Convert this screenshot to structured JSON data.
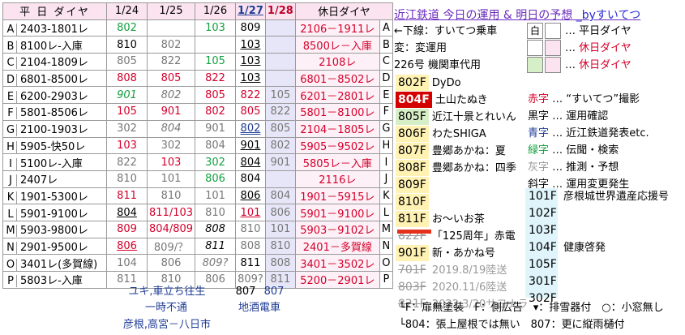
{
  "table": {
    "header": {
      "col_a": "平 日 ダイヤ",
      "dates": [
        "1/24",
        "1/25",
        "1/26",
        "1/27",
        "1/28"
      ],
      "holiday": "休日ダイヤ"
    },
    "rows": [
      {
        "letter": "A",
        "pair": "2403-1801レ",
        "d24": "802",
        "d25": "",
        "d26": "103",
        "d27": "809",
        "hol": "2106－1911レ",
        "letter2": "A"
      },
      {
        "letter": "B",
        "pair": "8100レ-入庫",
        "d24": "810",
        "d25": "802",
        "d26": "",
        "d27": "103",
        "hol": "8500レ－入庫",
        "letter2": "B"
      },
      {
        "letter": "C",
        "pair": "2104-1809レ",
        "d24": "805",
        "d25": "822",
        "d26": "105",
        "d27": "103",
        "hol": "2108レ",
        "letter2": "C"
      },
      {
        "letter": "D",
        "pair": "6801-8500レ",
        "d24": "808",
        "d25": "805",
        "d26": "822",
        "d27": "103",
        "hol": "6801－8502レ",
        "letter2": "D"
      },
      {
        "letter": "E",
        "pair": "6200-2903レ",
        "d24": "901",
        "d25": "802",
        "d26": "805",
        "d27": "822",
        "d28": "105",
        "hol": "6201－2801レ",
        "letter2": "E"
      },
      {
        "letter": "F",
        "pair": "5801-8506レ",
        "d24": "105",
        "d25": "901",
        "d26": "802",
        "d27": "805",
        "d28": "822",
        "hol": "5801－8100レ",
        "letter2": "F"
      },
      {
        "letter": "G",
        "pair": "2100-1903レ",
        "d24": "302",
        "d25": "804",
        "d26": "901",
        "d27": "802",
        "d28": "805",
        "hol": "2104－1805レ",
        "letter2": "G"
      },
      {
        "letter": "H",
        "pair": "5905-快50レ",
        "d24": "103",
        "d25": "302",
        "d26": "804",
        "d27": "901",
        "d28": "802",
        "hol": "5905－9502レ",
        "letter2": "H"
      },
      {
        "letter": "I",
        "pair": "5100レ-入庫",
        "d24": "822",
        "d25": "103",
        "d26": "302",
        "d27": "804",
        "d28": "901",
        "hol": "5805レ－入庫",
        "letter2": "I"
      },
      {
        "letter": "J",
        "pair": "2407レ",
        "d24": "810",
        "d25": "101",
        "d26": "806",
        "d27": "804",
        "d28": "",
        "hol": "2116レ",
        "letter2": "J"
      },
      {
        "letter": "K",
        "pair": "1901-5300レ",
        "d24": "811",
        "d25": "810",
        "d26": "101",
        "d27": "806",
        "d28": "804",
        "hol": "1901－5915レ",
        "letter2": "K"
      },
      {
        "letter": "L",
        "pair": "5901-9100レ",
        "d24": "804",
        "d25": "811/103",
        "d26": "810",
        "d27": "101",
        "d28": "806",
        "hol": "5901－9100レ",
        "letter2": "L"
      },
      {
        "letter": "M",
        "pair": "5903-9800レ",
        "d24": "809",
        "d25": "804/809",
        "d26": "808",
        "d27": "810",
        "d28": "101",
        "hol": "5903－9102レ",
        "letter2": "M"
      },
      {
        "letter": "N",
        "pair": "2901-9500レ",
        "d24": "806",
        "d25": "809/？",
        "d26": "811",
        "d27": "808",
        "d28": "810",
        "hol": "2401－多賀線",
        "letter2": "N"
      },
      {
        "letter": "O",
        "pair": "3401レ(多賀線)",
        "d24": "104",
        "d25": "806",
        "d26": "809?",
        "d27": "811",
        "d28": "808",
        "hol": "3401－3502レ",
        "letter2": "O"
      },
      {
        "letter": "P",
        "pair": "5803レ-入庫",
        "d24": "811",
        "d25": "810",
        "d26": "806",
        "d27": "809?",
        "d28": "811",
        "hol": "5200－2901レ",
        "letter2": "P"
      }
    ],
    "notes": [
      {
        "label": "ユキ,車立ち往生",
        "v27": "807",
        "v28": "807"
      },
      {
        "label": "一時不通",
        "v2": "地酒電車"
      },
      {
        "label": "彦根,高宮－八日市"
      }
    ]
  },
  "panel": {
    "title": "近江鉄道 今日の運用 & 明日の予想",
    "byline": "_byすいてつ",
    "legend_top": [
      {
        "text": "←下線：すいてつ乗車",
        "mark": "白",
        "desc": "平日ダイヤ"
      },
      {
        "text": "変：変運用",
        "mark": "",
        "desc": "休日ダイヤ"
      },
      {
        "text": "226号 機関車代用",
        "mark": "",
        "desc": "休日ダイヤ"
      }
    ],
    "cars": [
      {
        "num": "802F",
        "name": "DyDo"
      },
      {
        "num": "804F",
        "name": "土山たぬき"
      },
      {
        "num": "805F",
        "name": "近江十景とれいん"
      },
      {
        "num": "806F",
        "name": "わたSHIGA"
      },
      {
        "num": "807F",
        "name": "豊郷あかね：夏"
      },
      {
        "num": "808F",
        "name": "豊郷あかね：四季"
      },
      {
        "num": "809F",
        "name": ""
      },
      {
        "num": "810F",
        "name": ""
      },
      {
        "num": "811F",
        "name": "お～いお茶"
      },
      {
        "num": "822F",
        "name": "「125周年」赤電"
      },
      {
        "num": "901F",
        "name": "新・あかね号"
      },
      {
        "num": "701F",
        "name": "2019.8/19陸送"
      },
      {
        "num": "803F",
        "name": "2020.11/6陸送"
      },
      {
        "num": "821F",
        "name": "2022.3/20サヨナラ"
      }
    ],
    "key": [
      {
        "label": "赤字",
        "desc": "“すいてつ”撮影"
      },
      {
        "label": "黒字",
        "desc": "運用確認"
      },
      {
        "label": "青字",
        "desc": "近江鉄道発表etc."
      },
      {
        "label": "緑字",
        "desc": "伝聞・検索"
      },
      {
        "label": "灰字",
        "desc": "推測・予想"
      },
      {
        "label": "斜字",
        "desc": "運用変更発生"
      }
    ],
    "side_cars": [
      {
        "num": "101F",
        "desc": "彦根城世界遺産応援号"
      },
      {
        "num": "102F",
        "desc": ""
      },
      {
        "num": "103F",
        "desc": ""
      },
      {
        "num": "104F",
        "desc": "健康啓発"
      },
      {
        "num": "105F",
        "desc": ""
      },
      {
        "num": "301F",
        "desc": ""
      },
      {
        "num": "302F",
        "desc": ""
      }
    ],
    "footer": [
      "└F：扉無塗装　F：側広告　▾：排雪器付　○：小窓無し",
      "└804：張上屋根では無い　807：更に縦雨樋付"
    ]
  },
  "colors": {
    "red": "#d4002b",
    "blue": "#1f3c96",
    "green": "#13a040",
    "gray": "#777777",
    "pink": "#fbe4ef",
    "lav": "#e6e6f8"
  }
}
